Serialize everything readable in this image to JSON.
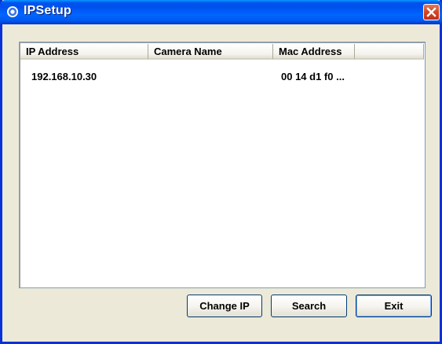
{
  "window": {
    "title": "IPSetup",
    "close_label": "Close"
  },
  "table": {
    "columns": [
      "IP Address",
      "Camera Name",
      "Mac Address",
      ""
    ],
    "rows": [
      {
        "ip": "192.168.10.30",
        "camera": "",
        "mac": "00 14 d1 f0 ..."
      }
    ]
  },
  "buttons": {
    "change_ip": "Change IP",
    "search": "Search",
    "exit": "Exit"
  }
}
